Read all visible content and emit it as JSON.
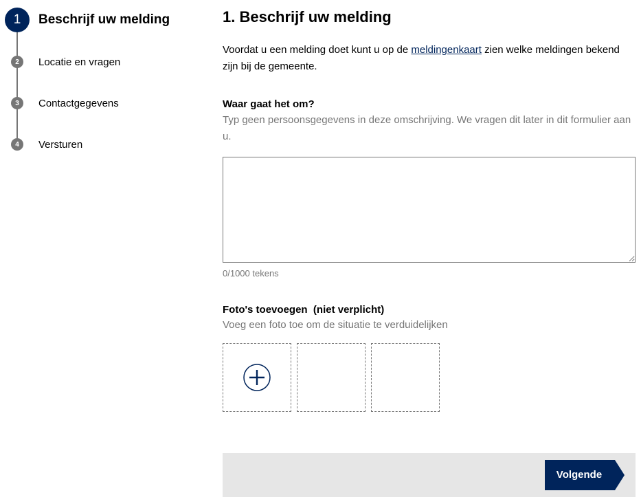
{
  "colors": {
    "accent": "#00245b",
    "muted": "#767676",
    "footer_bg": "#e6e6e6"
  },
  "stepper": {
    "steps": [
      {
        "number": "1",
        "label": "Beschrijf uw melding",
        "active": true
      },
      {
        "number": "2",
        "label": "Locatie en vragen",
        "active": false
      },
      {
        "number": "3",
        "label": "Contactgegevens",
        "active": false
      },
      {
        "number": "4",
        "label": "Versturen",
        "active": false
      }
    ]
  },
  "main": {
    "title": "1. Beschrijf uw melding",
    "intro_before": "Voordat u een melding doet kunt u op de ",
    "intro_link": "meldingenkaart",
    "intro_after": " zien welke meldingen bekend zijn bij de gemeente.",
    "question_label": "Waar gaat het om?",
    "question_help": "Typ geen persoonsgegevens in deze omschrijving. We vragen dit later in dit formulier aan u.",
    "description_value": "",
    "counter": "0/1000 tekens",
    "photo_label": "Foto's toevoegen  (niet verplicht)",
    "photo_help": "Voeg een foto toe om de situatie te verduidelijken",
    "photo_slots": [
      {
        "icon": "add-photo-icon"
      },
      {
        "icon": ""
      },
      {
        "icon": ""
      }
    ]
  },
  "footer": {
    "next_label": "Volgende"
  }
}
